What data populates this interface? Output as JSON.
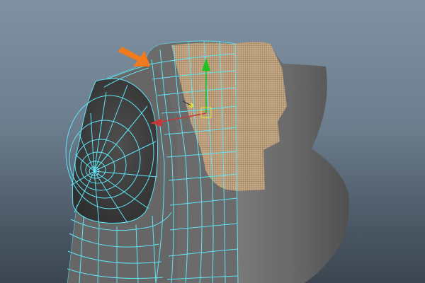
{
  "viewport": {
    "background_top": "#7f91a2",
    "background_bottom": "#3b4650"
  },
  "model": {
    "surface_color": "#6b6b6b",
    "wireframe_color": "#5fe3f5",
    "selected_faces_color": "#c2a581",
    "selected_faces_dot_color": "#8f7860"
  },
  "manipulator": {
    "type": "move-tool",
    "y_axis_color": "#1fc21f",
    "x_axis_color": "#c23a3a",
    "center_color": "#e6e62a"
  },
  "annotation": {
    "icon": "arrow-icon",
    "color": "#f07a1c"
  }
}
